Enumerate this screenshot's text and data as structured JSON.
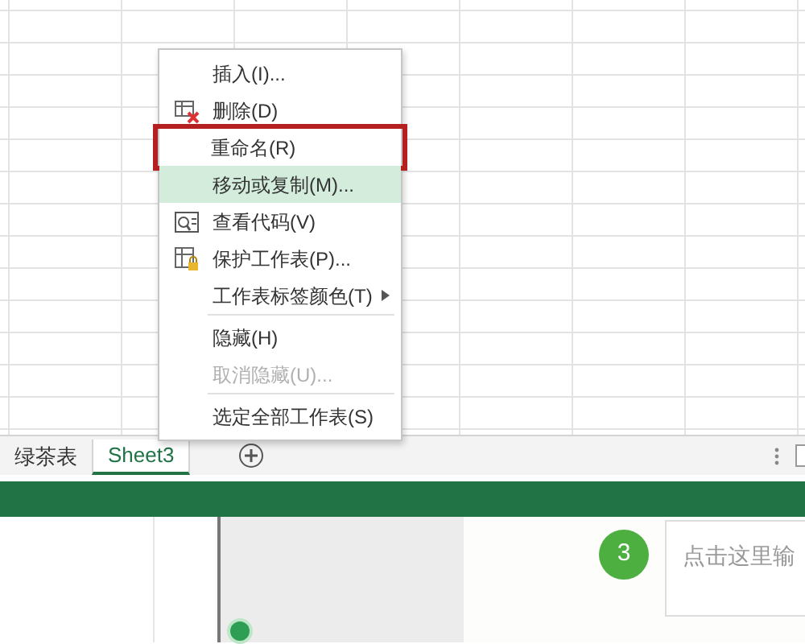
{
  "context_menu": {
    "items": [
      {
        "label": "插入(I)...",
        "kind": "plain",
        "disabled": false,
        "selected": false,
        "outlined": false,
        "submenu": false,
        "separator_before": false
      },
      {
        "label": "删除(D)",
        "kind": "delete",
        "disabled": false,
        "selected": false,
        "outlined": false,
        "submenu": false,
        "separator_before": false
      },
      {
        "label": "重命名(R)",
        "kind": "plain",
        "disabled": false,
        "selected": false,
        "outlined": true,
        "submenu": false,
        "separator_before": false
      },
      {
        "label": "移动或复制(M)...",
        "kind": "plain",
        "disabled": false,
        "selected": true,
        "outlined": false,
        "submenu": false,
        "separator_before": false
      },
      {
        "label": "查看代码(V)",
        "kind": "code",
        "disabled": false,
        "selected": false,
        "outlined": false,
        "submenu": false,
        "separator_before": false
      },
      {
        "label": "保护工作表(P)...",
        "kind": "protect",
        "disabled": false,
        "selected": false,
        "outlined": false,
        "submenu": false,
        "separator_before": false
      },
      {
        "label": "工作表标签颜色(T)",
        "kind": "plain",
        "disabled": false,
        "selected": false,
        "outlined": false,
        "submenu": true,
        "separator_before": false
      },
      {
        "label": "隐藏(H)",
        "kind": "plain",
        "disabled": false,
        "selected": false,
        "outlined": false,
        "submenu": false,
        "separator_before": true
      },
      {
        "label": "取消隐藏(U)...",
        "kind": "plain",
        "disabled": true,
        "selected": false,
        "outlined": false,
        "submenu": false,
        "separator_before": false
      },
      {
        "label": "选定全部工作表(S)",
        "kind": "plain",
        "disabled": false,
        "selected": false,
        "outlined": false,
        "submenu": false,
        "separator_before": true
      }
    ]
  },
  "sheet_tabs": [
    {
      "label": "绿茶表",
      "selected": false
    },
    {
      "label": "Sheet3",
      "selected": true
    }
  ],
  "step_badge": "3",
  "input": {
    "placeholder": "点击这里输"
  }
}
